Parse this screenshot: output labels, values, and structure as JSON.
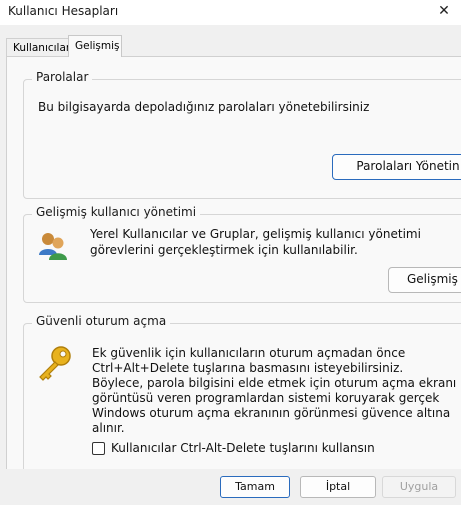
{
  "window": {
    "title": "Kullanıcı Hesapları",
    "close_glyph": "✕"
  },
  "tabs": [
    {
      "label": "Kullanıcılar"
    },
    {
      "label": "Gelişmiş"
    }
  ],
  "passwords": {
    "title": "Parolalar",
    "description": "Bu bilgisayarda depoladığınız parolaları yönetebilirsiniz",
    "button": "Parolaları Yönetin"
  },
  "advanced_user_mgmt": {
    "title": "Gelişmiş kullanıcı yönetimi",
    "line1": "Yerel Kullanıcılar ve Gruplar, gelişmiş kullanıcı yönetimi",
    "line2": "görevlerini gerçekleştirmek için kullanılabilir.",
    "button": "Gelişmiş",
    "icon": "users-icon"
  },
  "secure_logon": {
    "title": "Güvenli oturum açma",
    "lines": [
      "Ek güvenlik için kullanıcıların oturum açmadan önce",
      "Ctrl+Alt+Delete tuşlarına basmasını isteyebilirsiniz.",
      "Böylece, parola bilgisini elde etmek için oturum açma ekranı",
      "görüntüsü veren programlardan sistemi koruyarak gerçek",
      "Windows oturum açma ekranının görünmesi güvence altına",
      "alınır."
    ],
    "checkbox_label": "Kullanıcılar Ctrl-Alt-Delete tuşlarını kullansın",
    "checkbox_checked": false,
    "icon": "key-icon"
  },
  "footer": {
    "ok": "Tamam",
    "cancel": "İptal",
    "apply": "Uygula"
  }
}
